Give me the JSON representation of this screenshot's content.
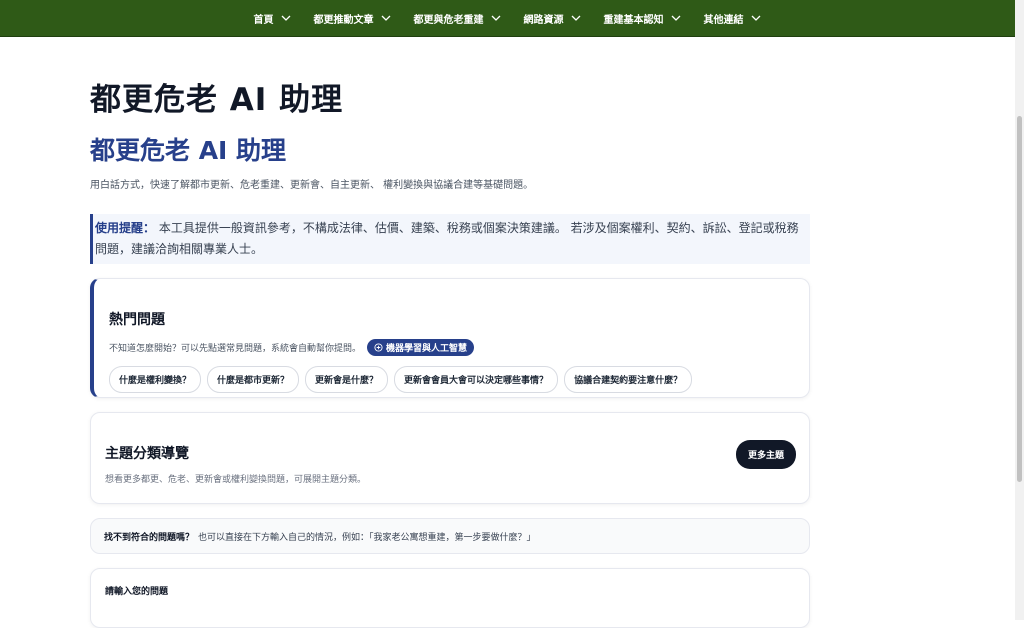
{
  "nav": {
    "items": [
      {
        "label": "首頁"
      },
      {
        "label": "都更推動文章"
      },
      {
        "label": "都更與危老重建"
      },
      {
        "label": "網路資源"
      },
      {
        "label": "重建基本認知"
      },
      {
        "label": "其他連結"
      }
    ]
  },
  "page": {
    "title": "都更危老 AI 助理",
    "heading": "都更危老 AI 助理",
    "intro": "用白話方式，快速了解都市更新、危老重建、更新會、自主更新、 權利變換與協議合建等基礎問題。"
  },
  "notice": {
    "label": "使用提醒：",
    "text": " 本工具提供一般資訊參考，不構成法律、估價、建築、稅務或個案決策建議。 若涉及個案權利、契約、訴訟、登記或稅務問題，建議洽詢相關專業人士。"
  },
  "hot": {
    "title": "熱門問題",
    "subtitle": "不知道怎麼開始？可以先點選常見問題，系統會自動幫你提問。",
    "badge": "機器學習與人工智慧",
    "questions": [
      {
        "label": "什麼是權利變換？"
      },
      {
        "label": "什麼是都市更新？"
      },
      {
        "label": "更新會是什麼？"
      },
      {
        "label": "更新會會員大會可以決定哪些事情？"
      },
      {
        "label": "協議合建契約要注意什麼？"
      }
    ]
  },
  "topics": {
    "title": "主題分類導覽",
    "subtitle": "想看更多都更、危老、更新會或權利變換問題，可展開主題分類。",
    "button": "更多主題"
  },
  "hint": {
    "bold": "找不到符合的問題嗎？",
    "text": "也可以直接在下方輸入自己的情況，例如：「我家老公寓想重建，第一步要做什麼？」"
  },
  "ask": {
    "label": "請輸入您的問題"
  },
  "colors": {
    "nav_bg": "#2f5a17",
    "accent": "#27408b",
    "button_dark": "#111827"
  },
  "icons": {
    "nav_dropdown": "chevron-down-icon",
    "badge": "plus-circle-icon"
  }
}
